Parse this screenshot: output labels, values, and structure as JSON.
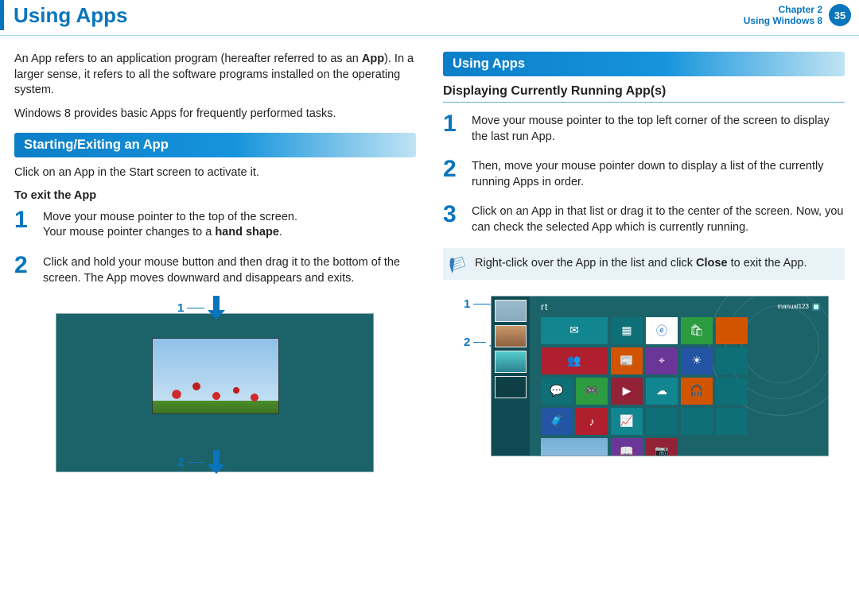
{
  "header": {
    "title": "Using Apps",
    "chapter_line1": "Chapter 2",
    "chapter_line2": "Using Windows 8",
    "page_number": "35"
  },
  "left": {
    "intro_before_bold": "An App refers to an application program (hereafter referred to as an ",
    "intro_bold": "App",
    "intro_after_bold": "). In a larger sense, it refers to all the software programs installed on the operating system.",
    "intro2": "Windows 8 provides basic Apps for frequently performed tasks.",
    "ribbon": "Starting/Exiting an App",
    "click_text": "Click on an App in the Start screen to activate it.",
    "exit_heading": "To exit the App",
    "step1_line1": "Move your mouse pointer to the top of the screen. ",
    "step1_line2a": "Your mouse pointer changes to a ",
    "step1_bold": "hand shape",
    "step1_line2b": ".",
    "step2": "Click and hold your mouse button and then drag it to the bottom of the screen. The App moves downward and disappears and exits.",
    "callout1": "1",
    "callout2": "2"
  },
  "right": {
    "ribbon": "Using Apps",
    "subhead": "Displaying Currently Running App(s)",
    "step1": "Move your mouse pointer to the top left corner of the screen to display the last run App.",
    "step2": "Then, move your mouse pointer down to display a list of the currently running Apps in order.",
    "step3": "Click on an App in that list or drag it to the center of the screen. Now, you can check the selected App which is currently running.",
    "note_before_bold": "Right-click over the App in the list and click ",
    "note_bold": "Close",
    "note_after_bold": " to exit the App.",
    "callout1": "1",
    "callout2": "2",
    "start_label_prefix": "rt",
    "user_label": "manual123"
  },
  "step_numbers": {
    "n1": "1",
    "n2": "2",
    "n3": "3"
  },
  "tiles": {
    "labels": [
      "Calendar",
      "Internet Explorer",
      "Store",
      "People",
      "News",
      "Maps",
      "Weather",
      "Games",
      "Video",
      "Music",
      "SkyDrive",
      "Travel",
      "Music",
      "Finance",
      "Camera"
    ]
  }
}
